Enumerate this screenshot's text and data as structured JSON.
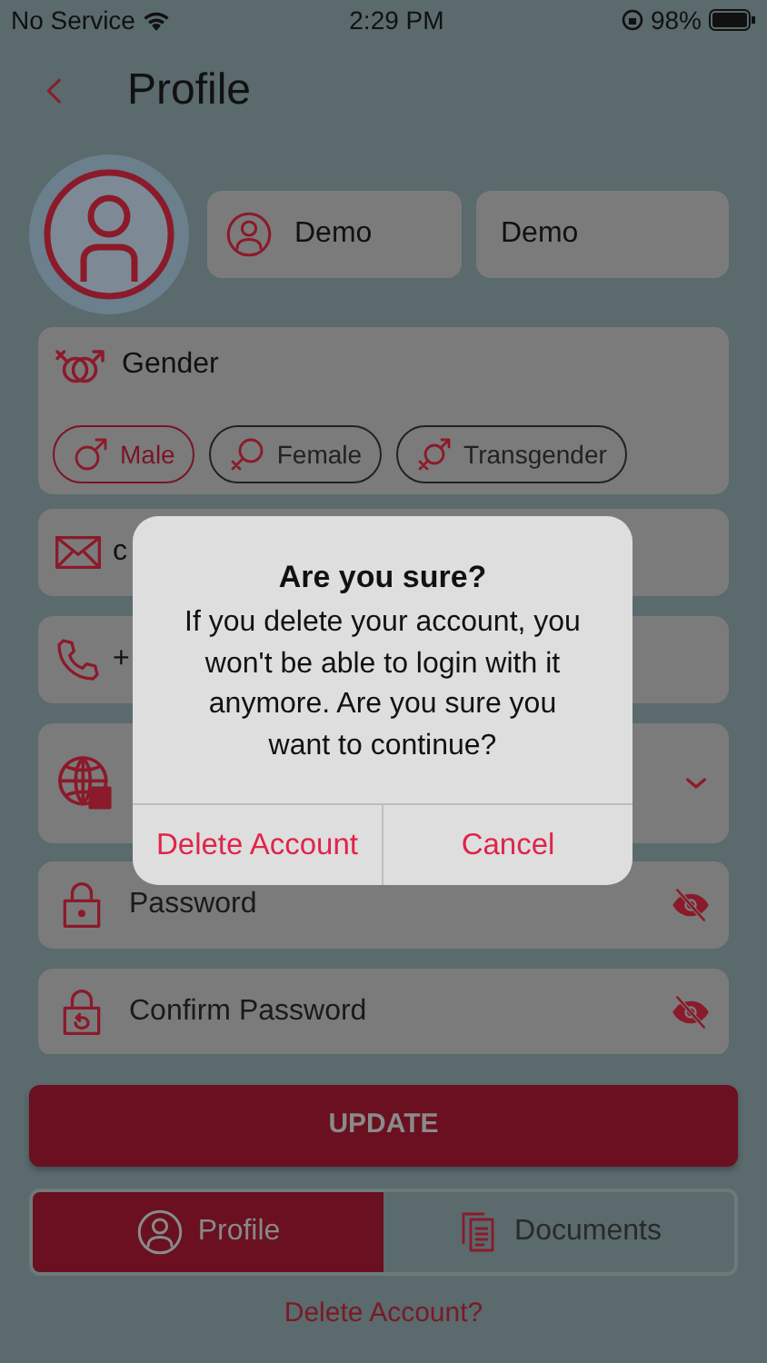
{
  "status_bar": {
    "carrier": "No Service",
    "time": "2:29 PM",
    "battery": "98%"
  },
  "header": {
    "title": "Profile"
  },
  "name_fields": [
    {
      "value": "Demo",
      "icon": true
    },
    {
      "value": "Demo",
      "icon": false
    }
  ],
  "gender": {
    "label": "Gender",
    "options": [
      {
        "label": "Male",
        "kind": "male",
        "selected": true
      },
      {
        "label": "Female",
        "kind": "female",
        "selected": false
      },
      {
        "label": "Transgender",
        "kind": "trans",
        "selected": false
      }
    ]
  },
  "email": {
    "value": "c"
  },
  "phone": {
    "value": "+"
  },
  "password_fields": [
    {
      "placeholder": "Password",
      "kind": "lock"
    },
    {
      "placeholder": "Confirm Password",
      "kind": "lock-reset"
    }
  ],
  "update_button": "UPDATE",
  "tabs": [
    {
      "label": "Profile",
      "kind": "profile",
      "selected": true
    },
    {
      "label": "Documents",
      "kind": "documents",
      "selected": false
    }
  ],
  "delete_link": "Delete Account?",
  "dialog": {
    "title": "Are you sure?",
    "message": "If you delete your account, you won't be able to login with it anymore. Are you sure you want to continue?",
    "buttons": [
      "Delete Account",
      "Cancel"
    ]
  }
}
